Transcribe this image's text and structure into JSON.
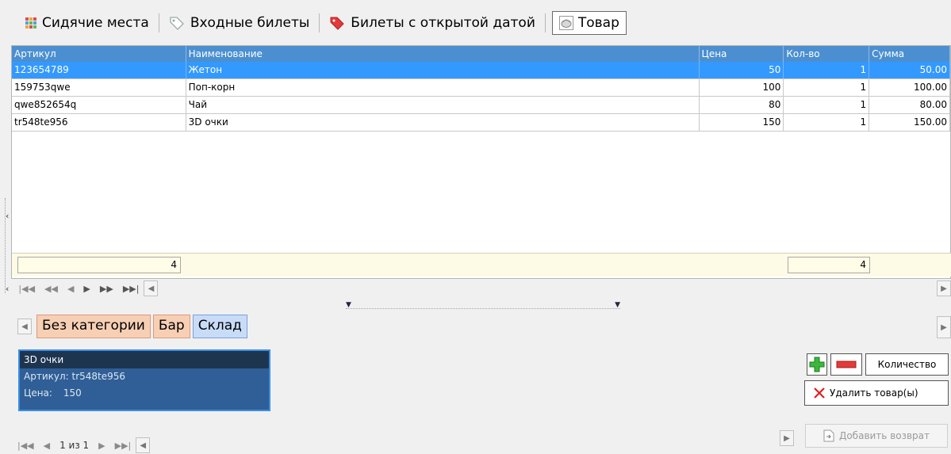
{
  "tabs": [
    {
      "label": "Сидячие места",
      "icon": "grid-icon"
    },
    {
      "label": "Входные билеты",
      "icon": "tag-outline-icon"
    },
    {
      "label": "Билеты с открытой датой",
      "icon": "tag-red-icon"
    },
    {
      "label": "Товар",
      "icon": "basket-icon",
      "active": true
    }
  ],
  "table": {
    "columns": [
      "Артикул",
      "Наименование",
      "Цена",
      "Кол-во",
      "Сумма"
    ],
    "rows": [
      {
        "sku": "123654789",
        "name": "Жетон",
        "price": "50",
        "qty": "1",
        "sum": "50.00",
        "selected": true
      },
      {
        "sku": "159753qwe",
        "name": "Поп-корн",
        "price": "100",
        "qty": "1",
        "sum": "100.00"
      },
      {
        "sku": "qwe852654q",
        "name": "Чай",
        "price": "80",
        "qty": "1",
        "sum": "80.00"
      },
      {
        "sku": "tr548te956",
        "name": "3D очки",
        "price": "150",
        "qty": "1",
        "sum": "150.00"
      }
    ],
    "footer_count": "4",
    "footer_qty": "4"
  },
  "categories": [
    {
      "label": "Без категории",
      "style": "brown"
    },
    {
      "label": "Бар",
      "style": "brown"
    },
    {
      "label": "Склад",
      "style": "blue"
    }
  ],
  "card": {
    "title": "3D очки",
    "sku_label": "Артикул:",
    "sku_value": "tr548te956",
    "price_label": "Цена:",
    "price_value": "150"
  },
  "buttons": {
    "quantity": "Количество",
    "delete": "Удалить товар(ы)",
    "add_return": "Добавить возврат"
  },
  "pager": {
    "text": "1 из 1"
  },
  "colors": {
    "header": "#4b8fd1",
    "selected_row": "#3399ff",
    "card": "#2f5f96"
  }
}
